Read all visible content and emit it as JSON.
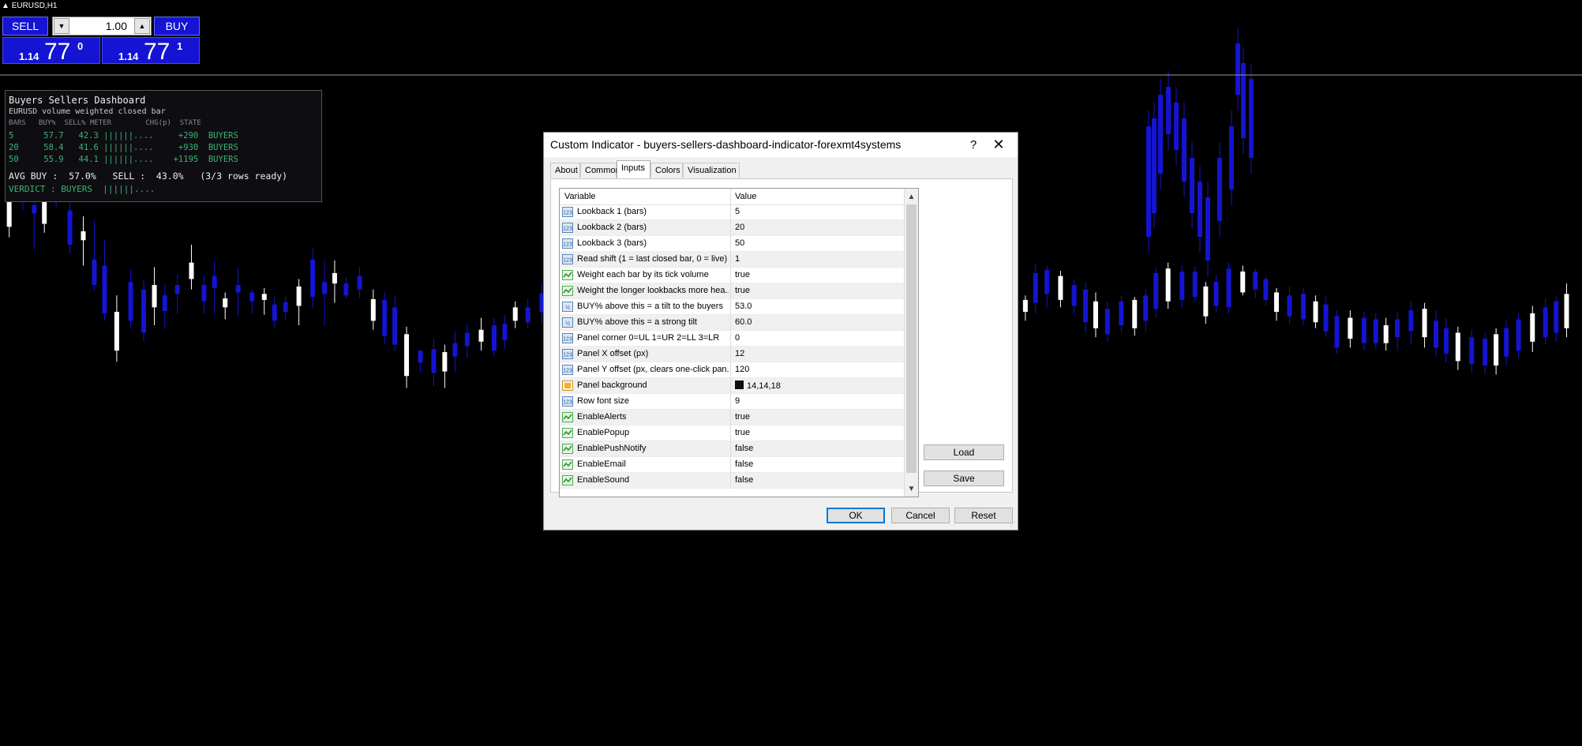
{
  "chart": {
    "symbol": "EURUSD,H1",
    "candles": [
      [
        0,
        252,
        318,
        264,
        304
      ],
      [
        1,
        239,
        282,
        247,
        270
      ],
      [
        2,
        262,
        334,
        275,
        286
      ],
      [
        3,
        248,
        312,
        260,
        300
      ],
      [
        4,
        230,
        278,
        253,
        262
      ],
      [
        5,
        270,
        340,
        282,
        328
      ],
      [
        6,
        290,
        356,
        310,
        322
      ],
      [
        7,
        296,
        390,
        348,
        382
      ],
      [
        8,
        322,
        430,
        356,
        420
      ],
      [
        9,
        396,
        485,
        418,
        470
      ],
      [
        10,
        362,
        440,
        378,
        430
      ],
      [
        11,
        375,
        458,
        388,
        446
      ],
      [
        12,
        358,
        436,
        382,
        412
      ],
      [
        13,
        381,
        441,
        396,
        417
      ],
      [
        14,
        368,
        421,
        382,
        394
      ],
      [
        15,
        328,
        388,
        352,
        374
      ],
      [
        16,
        369,
        420,
        382,
        404
      ],
      [
        17,
        350,
        420,
        370,
        386
      ],
      [
        18,
        392,
        428,
        400,
        412
      ],
      [
        19,
        360,
        425,
        382,
        392
      ],
      [
        20,
        388,
        420,
        392,
        404
      ],
      [
        21,
        386,
        422,
        394,
        402
      ],
      [
        22,
        398,
        440,
        408,
        430
      ],
      [
        23,
        398,
        429,
        405,
        418
      ],
      [
        24,
        374,
        436,
        384,
        410
      ],
      [
        25,
        333,
        412,
        348,
        398
      ],
      [
        26,
        350,
        436,
        378,
        394
      ],
      [
        27,
        349,
        406,
        366,
        380
      ],
      [
        28,
        372,
        400,
        380,
        396
      ],
      [
        29,
        358,
        400,
        370,
        388
      ],
      [
        30,
        388,
        442,
        401,
        430
      ],
      [
        31,
        392,
        462,
        402,
        450
      ],
      [
        32,
        396,
        470,
        412,
        462
      ],
      [
        33,
        438,
        520,
        448,
        504
      ],
      [
        34,
        469,
        499,
        470,
        486
      ],
      [
        35,
        454,
        518,
        468,
        500
      ],
      [
        36,
        462,
        520,
        472,
        498
      ],
      [
        37,
        444,
        498,
        460,
        478
      ],
      [
        38,
        434,
        480,
        446,
        464
      ],
      [
        39,
        426,
        470,
        442,
        458
      ],
      [
        40,
        426,
        478,
        436,
        470
      ],
      [
        41,
        422,
        468,
        434,
        456
      ],
      [
        42,
        404,
        440,
        412,
        430
      ],
      [
        43,
        400,
        440,
        412,
        432
      ],
      [
        44,
        380,
        432,
        393,
        418
      ],
      [
        45,
        380,
        462,
        396,
        422
      ],
      [
        46,
        378,
        448,
        395,
        432
      ],
      [
        47,
        392,
        448,
        404,
        430
      ],
      [
        48,
        400,
        448,
        410,
        432
      ],
      [
        49,
        400,
        434,
        414,
        420
      ],
      [
        50,
        412,
        448,
        420,
        436
      ],
      [
        51,
        404,
        440,
        410,
        432
      ],
      [
        52,
        406,
        445,
        410,
        420
      ],
      [
        53,
        398,
        442,
        406,
        428
      ],
      [
        54,
        398,
        434,
        406,
        418
      ],
      [
        55,
        426,
        480,
        436,
        458
      ],
      [
        56,
        412,
        462,
        420,
        442
      ],
      [
        57,
        446,
        494,
        454,
        482
      ],
      [
        58,
        424,
        476,
        434,
        466
      ],
      [
        59,
        420,
        470,
        430,
        458
      ],
      [
        60,
        404,
        454,
        416,
        444
      ],
      [
        61,
        366,
        426,
        383,
        416
      ],
      [
        62,
        364,
        426,
        376,
        414
      ],
      [
        63,
        363,
        406,
        373,
        396
      ],
      [
        64,
        377,
        424,
        384,
        410
      ],
      [
        65,
        378,
        420,
        386,
        404
      ],
      [
        66,
        378,
        428,
        392,
        418
      ],
      [
        67,
        380,
        426,
        386,
        414
      ],
      [
        68,
        384,
        418,
        388,
        410
      ],
      [
        69,
        376,
        416,
        380,
        408
      ],
      [
        70,
        392,
        438,
        400,
        430
      ],
      [
        71,
        396,
        434,
        404,
        420
      ],
      [
        72,
        398,
        444,
        408,
        432
      ],
      [
        73,
        400,
        456,
        414,
        448
      ],
      [
        74,
        400,
        452,
        412,
        440
      ],
      [
        75,
        401,
        444,
        410,
        432
      ],
      [
        76,
        402,
        442,
        406,
        426
      ],
      [
        77,
        398,
        436,
        408,
        426
      ],
      [
        78,
        402,
        448,
        410,
        436
      ],
      [
        79,
        406,
        456,
        418,
        446
      ],
      [
        80,
        401,
        444,
        410,
        430
      ],
      [
        81,
        392,
        442,
        402,
        422
      ],
      [
        82,
        390,
        434,
        398,
        426
      ],
      [
        83,
        389,
        429,
        394,
        421
      ],
      [
        84,
        396,
        430,
        402,
        418
      ],
      [
        85,
        354,
        420,
        366,
        406
      ],
      [
        86,
        356,
        412,
        362,
        394
      ],
      [
        87,
        363,
        412,
        370,
        402
      ],
      [
        88,
        374,
        420,
        382,
        410
      ],
      [
        89,
        378,
        446,
        388,
        432
      ],
      [
        90,
        392,
        452,
        404,
        440
      ],
      [
        91,
        404,
        458,
        414,
        448
      ],
      [
        92,
        396,
        446,
        404,
        436
      ],
      [
        93,
        398,
        450,
        402,
        440
      ],
      [
        94,
        388,
        444,
        396,
        430
      ],
      [
        95,
        358,
        426,
        366,
        414
      ],
      [
        96,
        352,
        414,
        360,
        404
      ],
      [
        97,
        356,
        412,
        364,
        402
      ],
      [
        98,
        358,
        404,
        364,
        398
      ],
      [
        99,
        378,
        434,
        384,
        424
      ],
      [
        100,
        368,
        418,
        378,
        410
      ],
      [
        101,
        352,
        420,
        360,
        412
      ],
      [
        102,
        356,
        396,
        364,
        392
      ],
      [
        103,
        360,
        400,
        364,
        388
      ],
      [
        104,
        370,
        410,
        374,
        402
      ],
      [
        105,
        386,
        430,
        392,
        418
      ],
      [
        106,
        384,
        434,
        396,
        424
      ],
      [
        107,
        386,
        436,
        394,
        428
      ],
      [
        108,
        396,
        440,
        404,
        432
      ],
      [
        109,
        398,
        452,
        408,
        444
      ],
      [
        110,
        416,
        474,
        424,
        466
      ],
      [
        111,
        416,
        466,
        426,
        454
      ],
      [
        112,
        418,
        470,
        426,
        460
      ],
      [
        113,
        420,
        468,
        428,
        460
      ],
      [
        114,
        426,
        470,
        436,
        460
      ],
      [
        115,
        418,
        470,
        428,
        452
      ],
      [
        116,
        404,
        462,
        416,
        444
      ],
      [
        117,
        406,
        466,
        414,
        452
      ],
      [
        118,
        416,
        478,
        430,
        466
      ],
      [
        119,
        426,
        486,
        440,
        474
      ],
      [
        120,
        438,
        496,
        446,
        484
      ],
      [
        121,
        442,
        500,
        452,
        488
      ],
      [
        122,
        446,
        502,
        454,
        490
      ],
      [
        123,
        440,
        502,
        448,
        490
      ],
      [
        124,
        430,
        490,
        440,
        478
      ],
      [
        125,
        420,
        480,
        428,
        470
      ],
      [
        126,
        410,
        472,
        420,
        458
      ],
      [
        127,
        400,
        462,
        412,
        452
      ],
      [
        128,
        398,
        458,
        404,
        446
      ],
      [
        129,
        380,
        452,
        394,
        440
      ]
    ],
    "hline_price": "1.1477"
  },
  "trade_panel": {
    "sell_label": "SELL",
    "buy_label": "BUY",
    "lot": "1.00",
    "sell_small": "1.14",
    "sell_big": "77",
    "sell_sup": "0",
    "buy_small": "1.14",
    "buy_big": "77",
    "buy_sup": "1"
  },
  "dashboard": {
    "title": "Buyers Sellers Dashboard",
    "subtitle": "EURUSD  volume weighted  closed bar",
    "header": "BARS   BUY%  SELL% METER        CHG(p)  STATE",
    "rows": [
      "5      57.7   42.3 ||||||....     +290  BUYERS",
      "20     58.4   41.6 ||||||....     +930  BUYERS",
      "50     55.9   44.1 ||||||....    +1195  BUYERS"
    ],
    "avg": "AVG BUY :  57.0%   SELL :  43.0%   (3/3 rows ready)",
    "verdict": "VERDICT : BUYERS  ||||||...."
  },
  "dialog": {
    "title": "Custom Indicator - buyers-sellers-dashboard-indicator-forexmt4systems",
    "help": "?",
    "close": "✕",
    "tabs": [
      "About",
      "Common",
      "Inputs",
      "Colors",
      "Visualization"
    ],
    "active_tab": "Inputs",
    "col_variable": "Variable",
    "col_value": "Value",
    "rows": [
      {
        "name": "Lookback 1 (bars)",
        "value": "5",
        "icon": "int"
      },
      {
        "name": "Lookback 2 (bars)",
        "value": "20",
        "icon": "int"
      },
      {
        "name": "Lookback 3 (bars)",
        "value": "50",
        "icon": "int"
      },
      {
        "name": "Read shift (1 = last closed bar, 0 = live)",
        "value": "1",
        "icon": "int"
      },
      {
        "name": "Weight each bar by its tick volume",
        "value": "true",
        "icon": "bool"
      },
      {
        "name": "Weight the longer lookbacks more hea...",
        "value": "true",
        "icon": "bool"
      },
      {
        "name": "BUY% above this = a tilt to the buyers",
        "value": "53.0",
        "icon": "double"
      },
      {
        "name": "BUY% above this = a strong tilt",
        "value": "60.0",
        "icon": "double"
      },
      {
        "name": "Panel corner 0=UL 1=UR 2=LL 3=LR",
        "value": "0",
        "icon": "int"
      },
      {
        "name": "Panel X offset (px)",
        "value": "12",
        "icon": "int"
      },
      {
        "name": "Panel Y offset (px, clears one-click pan...",
        "value": "120",
        "icon": "int"
      },
      {
        "name": "Panel background",
        "value": "14,14,18",
        "icon": "color"
      },
      {
        "name": "Row font size",
        "value": "9",
        "icon": "int"
      },
      {
        "name": "EnableAlerts",
        "value": "true",
        "icon": "bool"
      },
      {
        "name": "EnablePopup",
        "value": "true",
        "icon": "bool"
      },
      {
        "name": "EnablePushNotify",
        "value": "false",
        "icon": "bool"
      },
      {
        "name": "EnableEmail",
        "value": "false",
        "icon": "bool"
      },
      {
        "name": "EnableSound",
        "value": "false",
        "icon": "bool"
      }
    ],
    "buttons": {
      "load": "Load",
      "save": "Save",
      "ok": "OK",
      "cancel": "Cancel",
      "reset": "Reset"
    },
    "colors": {
      "blue": "#1414d2",
      "green": "#3cb371"
    }
  }
}
